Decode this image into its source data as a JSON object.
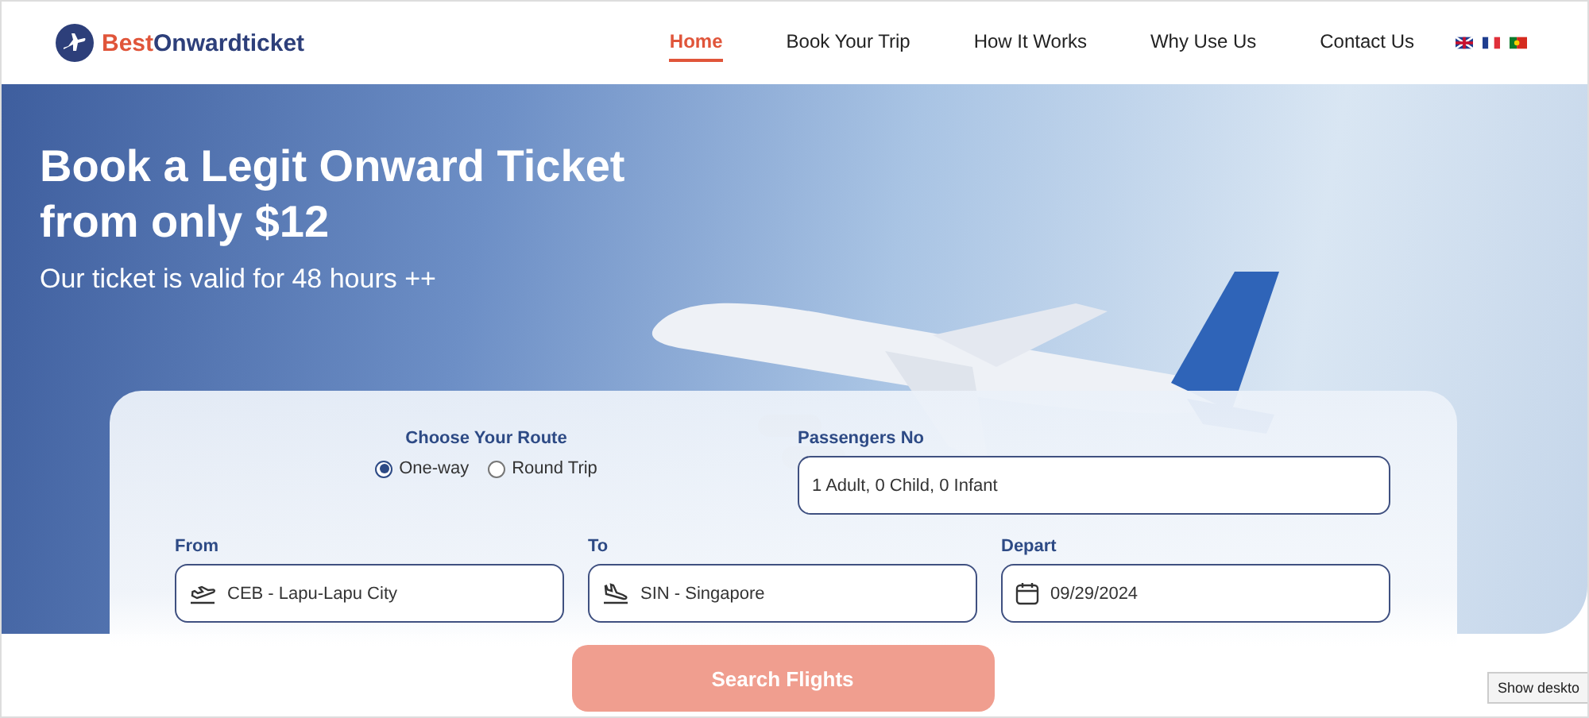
{
  "header": {
    "logo": {
      "first": "Best",
      "second": "Onwardticket"
    },
    "nav": [
      {
        "label": "Home",
        "selected": true
      },
      {
        "label": "Book Your Trip",
        "selected": false
      },
      {
        "label": "How It Works",
        "selected": false
      },
      {
        "label": "Why Use Us",
        "selected": false
      },
      {
        "label": "Contact Us",
        "selected": false
      }
    ],
    "languages": [
      {
        "kind": "uk"
      },
      {
        "kind": "fr"
      },
      {
        "kind": "pt"
      }
    ]
  },
  "hero": {
    "title_lines": [
      "Book a Legit Onward Ticket",
      "from only $12"
    ],
    "subtitle": "Our ticket is valid for 48 hours ++"
  },
  "search_form": {
    "route_label": "Choose Your Route",
    "routes": [
      {
        "label": "One-way",
        "selected": true
      },
      {
        "label": "Round Trip",
        "selected": false
      }
    ],
    "passengers_label": "Passengers No",
    "passengers_value": "1 Adult, 0 Child, 0 Infant",
    "fields": [
      {
        "kind": "departure",
        "label": "From",
        "value": "CEB - Lapu-Lapu City"
      },
      {
        "kind": "arrival",
        "label": "To",
        "value": "SIN - Singapore"
      },
      {
        "kind": "date",
        "label": "Depart",
        "value": "09/29/2024"
      }
    ],
    "submit": "Search Flights"
  },
  "tooltip": "Show deskto"
}
